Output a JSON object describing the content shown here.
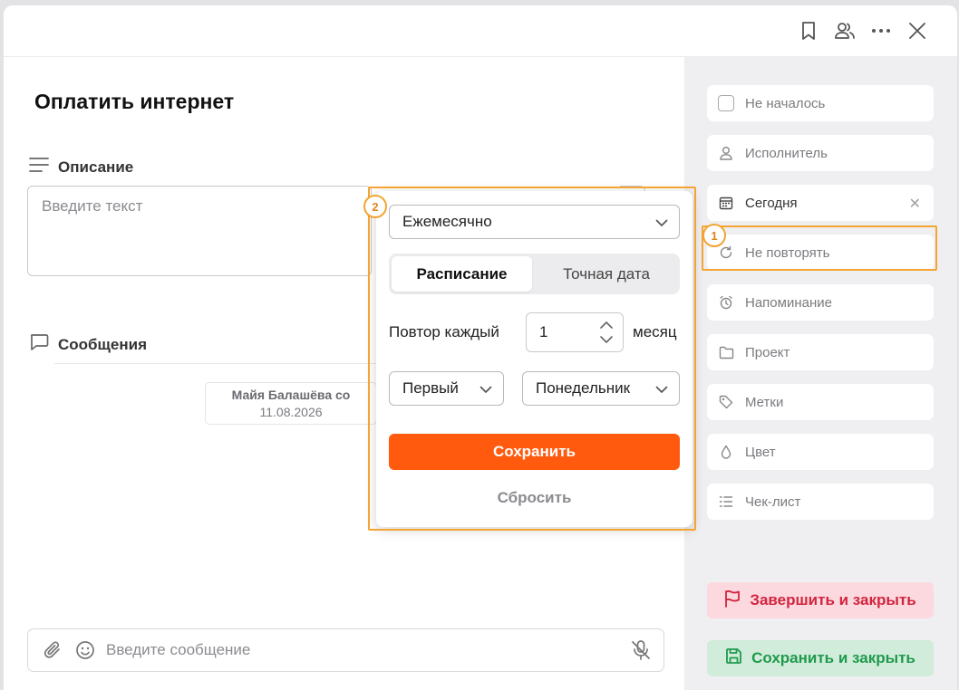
{
  "task": {
    "title": "Оплатить интернет",
    "description_label": "Описание",
    "description_placeholder": "Введите текст",
    "messages_label": "Сообщения",
    "message_author": "Майя Балашёва со",
    "message_date": "11.08.2026",
    "composer_placeholder": "Введите сообщение"
  },
  "sidebar": {
    "items": [
      {
        "label": "Не началось",
        "icon": "checkbox"
      },
      {
        "label": "Исполнитель",
        "icon": "user-icon"
      },
      {
        "label": "Сегодня",
        "icon": "calendar-icon",
        "clear": "✕"
      },
      {
        "label": "Не повторять",
        "icon": "repeat-icon"
      },
      {
        "label": "Напоминание",
        "icon": "alarm-icon"
      },
      {
        "label": "Проект",
        "icon": "folder-icon"
      },
      {
        "label": "Метки",
        "icon": "tag-icon"
      },
      {
        "label": "Цвет",
        "icon": "drop-icon"
      },
      {
        "label": "Чек-лист",
        "icon": "checklist-icon"
      }
    ],
    "finish_label": "Завершить и закрыть",
    "save_close_label": "Сохранить и закрыть"
  },
  "popup": {
    "frequency": "Ежемесячно",
    "tab_schedule": "Расписание",
    "tab_exact_date": "Точная дата",
    "repeat_every_label": "Повтор каждый",
    "repeat_value": "1",
    "repeat_unit": "месяц",
    "ordinal": "Первый",
    "weekday": "Понедельник",
    "save_label": "Сохранить",
    "reset_label": "Сбросить"
  },
  "annotations": {
    "badge1": "1",
    "badge2": "2"
  },
  "colors": {
    "accent": "#ff5a0d",
    "highlight": "#f5a433",
    "finish_text": "#d3243f",
    "save_close_text": "#1f9a4c"
  }
}
